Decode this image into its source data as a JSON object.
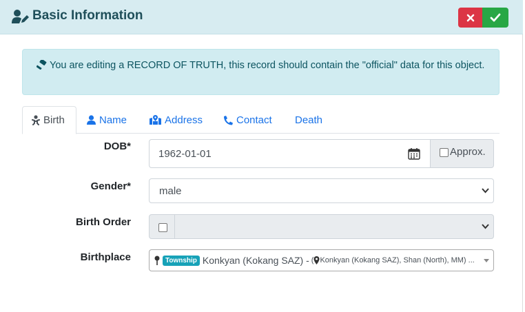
{
  "header": {
    "title": "Basic Information",
    "cancel_icon": "times-icon",
    "save_icon": "check-icon"
  },
  "alert": {
    "text": "You are editing a RECORD OF TRUTH, this record should contain the \"official\" data for this object."
  },
  "tabs": [
    {
      "label": "Birth",
      "icon": "baby-icon",
      "active": true
    },
    {
      "label": "Name",
      "icon": "user-icon",
      "active": false
    },
    {
      "label": "Address",
      "icon": "map-marked-icon",
      "active": false
    },
    {
      "label": "Contact",
      "icon": "phone-icon",
      "active": false
    },
    {
      "label": "Death",
      "icon": "",
      "active": false
    }
  ],
  "form": {
    "dob_label": "DOB*",
    "dob_value": "1962-01-01",
    "approx_label": "Approx.",
    "gender_label": "Gender*",
    "gender_value": "male",
    "birth_order_label": "Birth Order",
    "birth_order_value": "",
    "birthplace_label": "Birthplace",
    "birthplace_badge": "Township",
    "birthplace_name": "Konkyan (Kokang SAZ) -",
    "birthplace_detail": "Konkyan (Kokang SAZ), Shan (North), MM) ..."
  },
  "colors": {
    "header_bg": "#d7ecf1",
    "alert_bg": "#d1ecf1",
    "danger": "#dc3545",
    "success": "#28a745",
    "link": "#1a73e8",
    "badge": "#17a2b8"
  }
}
